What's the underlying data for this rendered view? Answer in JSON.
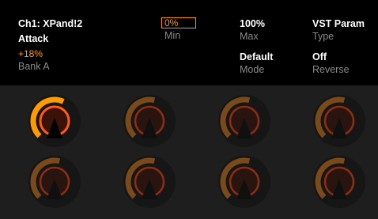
{
  "header": {
    "track_name": "Ch1: XPand!2",
    "parameter_name": "Attack",
    "parameter_value": "+18%",
    "bank_name": "Bank A",
    "min": {
      "value": "0%",
      "label": "Min"
    },
    "max": {
      "value": "100%",
      "label": "Max"
    },
    "type": {
      "value": "VST Param",
      "label": "Type"
    },
    "mode": {
      "value": "Default",
      "label": "Mode"
    },
    "reverse": {
      "value": "Off",
      "label": "Reverse"
    }
  },
  "knobs": [
    {
      "name": "knob-1",
      "selected": true,
      "level": 0.59
    },
    {
      "name": "knob-2",
      "selected": false,
      "level": 0.55
    },
    {
      "name": "knob-3",
      "selected": false,
      "level": 0.55
    },
    {
      "name": "knob-4",
      "selected": false,
      "level": 0.55
    },
    {
      "name": "knob-5",
      "selected": false,
      "level": 0.55
    },
    {
      "name": "knob-6",
      "selected": false,
      "level": 0.55
    },
    {
      "name": "knob-7",
      "selected": false,
      "level": 0.55
    },
    {
      "name": "knob-8",
      "selected": false,
      "level": 0.55
    }
  ],
  "colors": {
    "accent": "#ff9a00",
    "active_ring": "#ff5a1a",
    "inactive_arc": "#7a4a1a",
    "inactive_ring": "#8a2e14",
    "knob_body": "#2a1410",
    "background": "#1e1e1e",
    "header_background": "#000000"
  }
}
